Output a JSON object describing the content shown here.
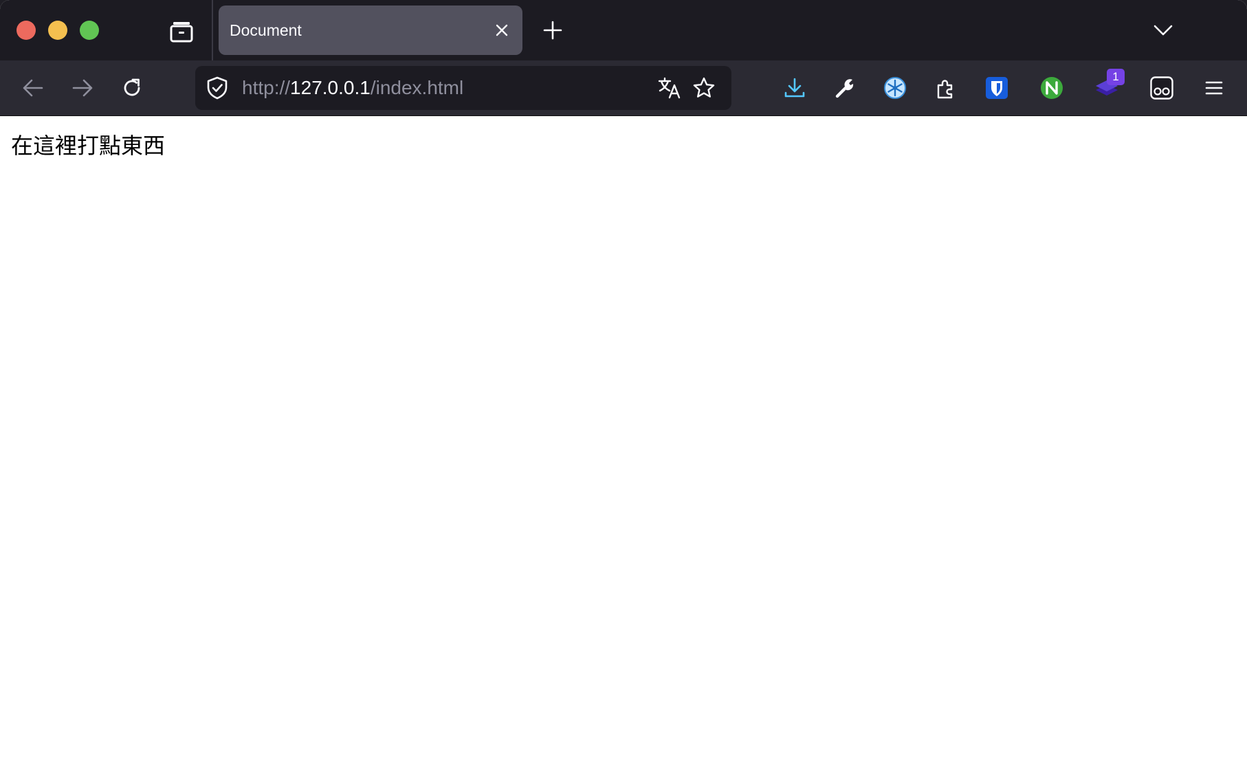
{
  "window": {
    "traffic_lights": {
      "close": "#ed6a5e",
      "minimize": "#f4bf4f",
      "maximize": "#61c554"
    }
  },
  "tabs": [
    {
      "title": "Document",
      "active": true
    }
  ],
  "toolbar": {
    "url": {
      "scheme": "http://",
      "host": "127.0.0.1",
      "path": "/index.html"
    },
    "extensions": [
      {
        "icon": "downloads-icon",
        "color": "#54ffbd"
      },
      {
        "icon": "wrench-icon"
      },
      {
        "icon": "snowflake-extension-icon"
      },
      {
        "icon": "extensions-puzzle-icon"
      },
      {
        "icon": "bitwarden-icon",
        "color": "#175ddc"
      },
      {
        "icon": "green-n-extension-icon",
        "color": "#3caa3c"
      },
      {
        "icon": "stacked-extension-icon",
        "badge": "1"
      },
      {
        "icon": "glasses-extension-icon"
      },
      {
        "icon": "hamburger-menu-icon"
      }
    ]
  },
  "content": {
    "text": "在這裡打點東西"
  },
  "colors": {
    "tabstrip_bg": "#1c1b22",
    "toolbar_bg": "#2b2a33",
    "active_tab_bg": "#52515e",
    "url_text_dim": "#8f8f9d",
    "url_text_bright": "#fbfbfe"
  }
}
